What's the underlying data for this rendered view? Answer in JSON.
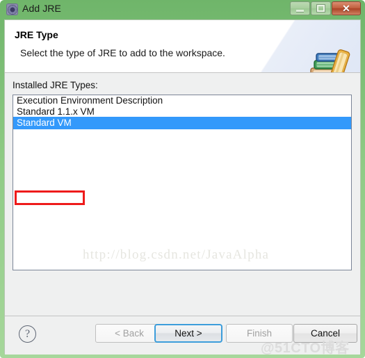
{
  "window": {
    "title": "Add JRE",
    "icon": "jre-gear-icon",
    "controls": {
      "minimize_label": "–",
      "maximize_label": "□",
      "close_label": "✕"
    },
    "frame_color": "#8fcb85"
  },
  "header": {
    "title": "JRE Type",
    "description": "Select the type of JRE to add to the workspace.",
    "icon": "books-icon"
  },
  "content": {
    "list_label": "Installed JRE Types:",
    "items": [
      {
        "label": "Execution Environment Description",
        "selected": false
      },
      {
        "label": "Standard 1.1.x VM",
        "selected": false
      },
      {
        "label": "Standard VM",
        "selected": true
      }
    ],
    "selection_color": "#3399fb",
    "annotation": {
      "target": "Standard VM",
      "color": "#ee1b1b"
    }
  },
  "watermarks": {
    "url": "http://blog.csdn.net/JavaAlpha",
    "site": "@51CTO博客"
  },
  "buttons": {
    "help_label": "?",
    "back_label": "< Back",
    "next_label": "Next >",
    "finish_label": "Finish",
    "cancel_label": "Cancel"
  }
}
